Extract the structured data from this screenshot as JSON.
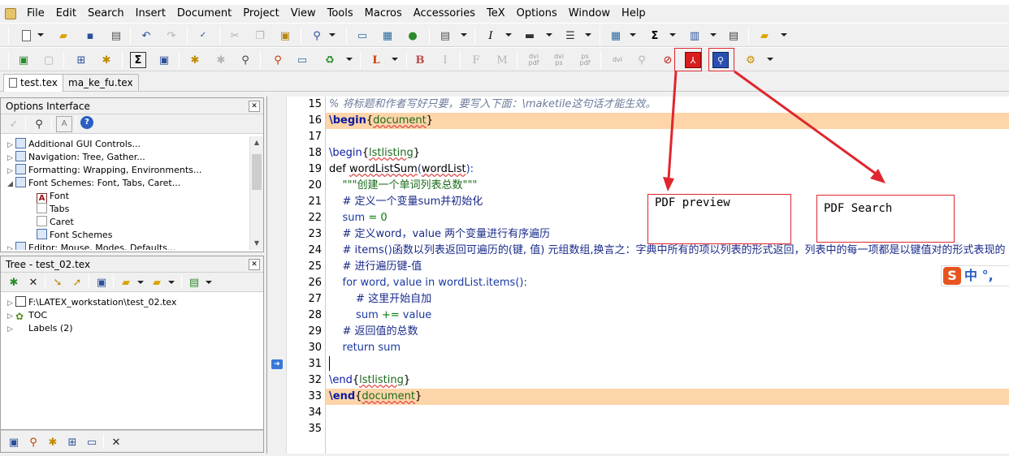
{
  "menu": [
    "File",
    "Edit",
    "Search",
    "Insert",
    "Document",
    "Project",
    "View",
    "Tools",
    "Macros",
    "Accessories",
    "TeX",
    "Options",
    "Window",
    "Help"
  ],
  "toolbar2_labels": {
    "bold": "B",
    "italic": "I",
    "f": "F",
    "m": "M",
    "dvi_pdf": "dvi pdf",
    "dvi_ps": "dvi ps",
    "ps_pdf": "ps pdf",
    "dvi": "dvi",
    "sum": "Σ"
  },
  "tabs": [
    {
      "label": "test.tex",
      "active": true
    },
    {
      "label": "ma_ke_fu.tex",
      "active": false
    }
  ],
  "options_panel": {
    "title": "Options Interface",
    "items": [
      {
        "label": "Additional GUI Controls...",
        "expanded": false,
        "level": 0
      },
      {
        "label": "Navigation: Tree, Gather...",
        "expanded": false,
        "level": 0
      },
      {
        "label": "Formatting: Wrapping, Environments...",
        "expanded": false,
        "level": 0
      },
      {
        "label": "Font Schemes: Font, Tabs, Caret...",
        "expanded": true,
        "level": 0
      },
      {
        "label": "Font",
        "level": 1,
        "selected": true
      },
      {
        "label": "Tabs",
        "level": 1
      },
      {
        "label": "Caret",
        "level": 1
      },
      {
        "label": "Font Schemes",
        "level": 1
      },
      {
        "label": "Editor: Mouse, Modes, Defaults...",
        "expanded": false,
        "level": 0
      }
    ]
  },
  "tree_panel": {
    "title": "Tree - test_02.tex",
    "items": [
      {
        "label": "F:\\LATEX_workstation\\test_02.tex"
      },
      {
        "label": "TOC"
      },
      {
        "label": "Labels  (2)"
      }
    ]
  },
  "editor": {
    "line_numbers": [
      "15",
      "16",
      "17",
      "18",
      "19",
      "20",
      "21",
      "22",
      "23",
      "24",
      "25",
      "26",
      "27",
      "28",
      "29",
      "30",
      "31",
      "32",
      "33",
      "34",
      "35"
    ],
    "lines": {
      "l15": "% 将标题和作者写好只要，要写入下面：\\maketile这句话才能生效。",
      "l16_cmd": "\\begin",
      "l16_arg": "document",
      "l18_cmd": "\\begin",
      "l18_arg": "lstlisting",
      "l19_a": "def ",
      "l19_b": "wordListSum",
      "l19_c": "(",
      "l19_d": "wordList",
      "l19_e": "):",
      "l20": "    \"\"\"创建一个单词列表总数\"\"\"",
      "l21": "    # 定义一个变量sum并初始化",
      "l22_a": "    sum ",
      "l22_b": "= ",
      "l22_c": "0",
      "l23": "    # 定义word，value 两个变量进行有序遍历",
      "l24_a": "    # items",
      "l24_b": "()",
      "l24_c": "函数以列表返回可遍历的(键, 值) 元组数组,换言之：字典中所有的项以列表的形式返回，列表中的每一项都是以键值对的形式表现的",
      "l25": "    # 进行遍历键-值",
      "l26_a": "    for word, value in wordList.items",
      "l26_b": "():",
      "l27": "        # 这里开始自加",
      "l28_a": "        sum ",
      "l28_b": "+= ",
      "l28_c": "value",
      "l29": "    # 返回值的总数",
      "l30": "    return sum",
      "l32_cmd": "\\end",
      "l32_arg": "lstlisting",
      "l33_cmd": "\\end",
      "l33_arg": "document"
    }
  },
  "annotations": {
    "pdf_preview": "PDF preview",
    "pdf_search": "PDF Search"
  },
  "ime": {
    "logo": "S",
    "label": "中 °,"
  },
  "colors": {
    "highlight": "#fdd5a8",
    "annotation": "#e0262e",
    "keyword": "#0a1aa0",
    "arg": "#1a6a1a"
  }
}
